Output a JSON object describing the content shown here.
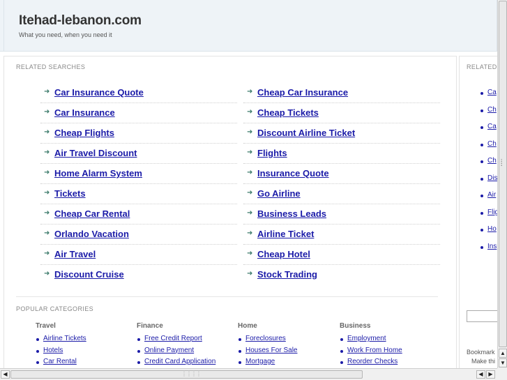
{
  "header": {
    "title": "Itehad-lebanon.com",
    "tagline": "What you need, when you need it"
  },
  "related_searches": {
    "label": "RELATED SEARCHES",
    "left": [
      "Car Insurance Quote",
      "Car Insurance",
      "Cheap Flights",
      "Air Travel Discount",
      "Home Alarm System",
      "Tickets",
      "Cheap Car Rental",
      "Orlando Vacation",
      "Air Travel",
      "Discount Cruise"
    ],
    "right": [
      "Cheap Car Insurance",
      "Cheap Tickets",
      "Discount Airline Ticket",
      "Flights",
      "Insurance Quote",
      "Go Airline",
      "Business Leads",
      "Airline Ticket",
      "Cheap Hotel",
      "Stock Trading"
    ]
  },
  "popular_categories": {
    "label": "POPULAR CATEGORIES",
    "columns": [
      {
        "title": "Travel",
        "items": [
          "Airline Tickets",
          "Hotels",
          "Car Rental"
        ]
      },
      {
        "title": "Finance",
        "items": [
          "Free Credit Report",
          "Online Payment",
          "Credit Card Application"
        ]
      },
      {
        "title": "Home",
        "items": [
          "Foreclosures",
          "Houses For Sale",
          "Mortgage"
        ]
      },
      {
        "title": "Business",
        "items": [
          "Employment",
          "Work From Home",
          "Reorder Checks"
        ]
      }
    ]
  },
  "sidebar": {
    "label": "RELATED",
    "items": [
      "Ca",
      "Ch",
      "Ca",
      "Ch",
      "Ch",
      "Dis",
      "Air",
      "Flig",
      "Ho",
      "Ins"
    ],
    "bookmark_line1": "Bookmark",
    "bookmark_line2": "Make thi"
  },
  "icons": {
    "arrow": "right-arrow-icon",
    "scroll_up": "up-arrow-icon",
    "scroll_down": "down-arrow-icon",
    "scroll_left": "left-arrow-icon",
    "scroll_right": "right-arrow-icon"
  },
  "colors": {
    "link": "#1b1ba8",
    "header_bg": "#eef3f7",
    "arrow": "#3a7a6a"
  }
}
